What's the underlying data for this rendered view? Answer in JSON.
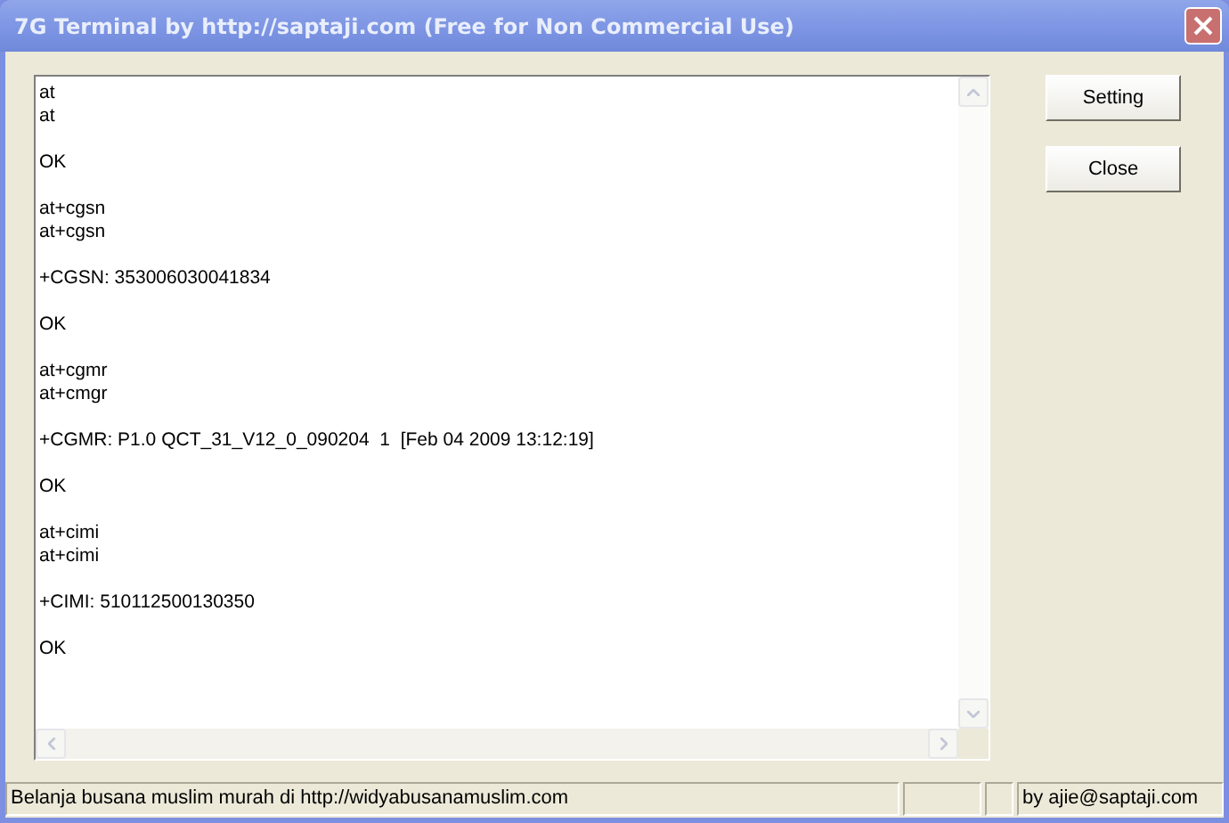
{
  "window": {
    "title": "7G Terminal by http://saptaji.com (Free for Non Commercial Use)"
  },
  "terminal": {
    "blocks": [
      [
        "at",
        "at"
      ],
      [
        "OK"
      ],
      [
        "at+cgsn",
        "at+cgsn"
      ],
      [
        "+CGSN: 353006030041834"
      ],
      [
        "OK"
      ],
      [
        "at+cgmr",
        "at+cmgr"
      ],
      [
        "+CGMR: P1.0 QCT_31_V12_0_090204  1  [Feb 04 2009 13:12:19]"
      ],
      [
        "OK"
      ],
      [
        "at+cimi",
        "at+cimi"
      ],
      [
        "+CIMI: 510112500130350"
      ],
      [
        "OK"
      ]
    ]
  },
  "buttons": [
    "Setting",
    "Close"
  ],
  "status_bar": {
    "panels": [
      {
        "kind": "text",
        "text": "Belanja busana muslim murah di http://widyabusanamuslim.com"
      },
      {
        "kind": "blank"
      },
      {
        "kind": "blank"
      },
      {
        "kind": "text",
        "text": "by ajie@saptaji.com"
      }
    ]
  }
}
